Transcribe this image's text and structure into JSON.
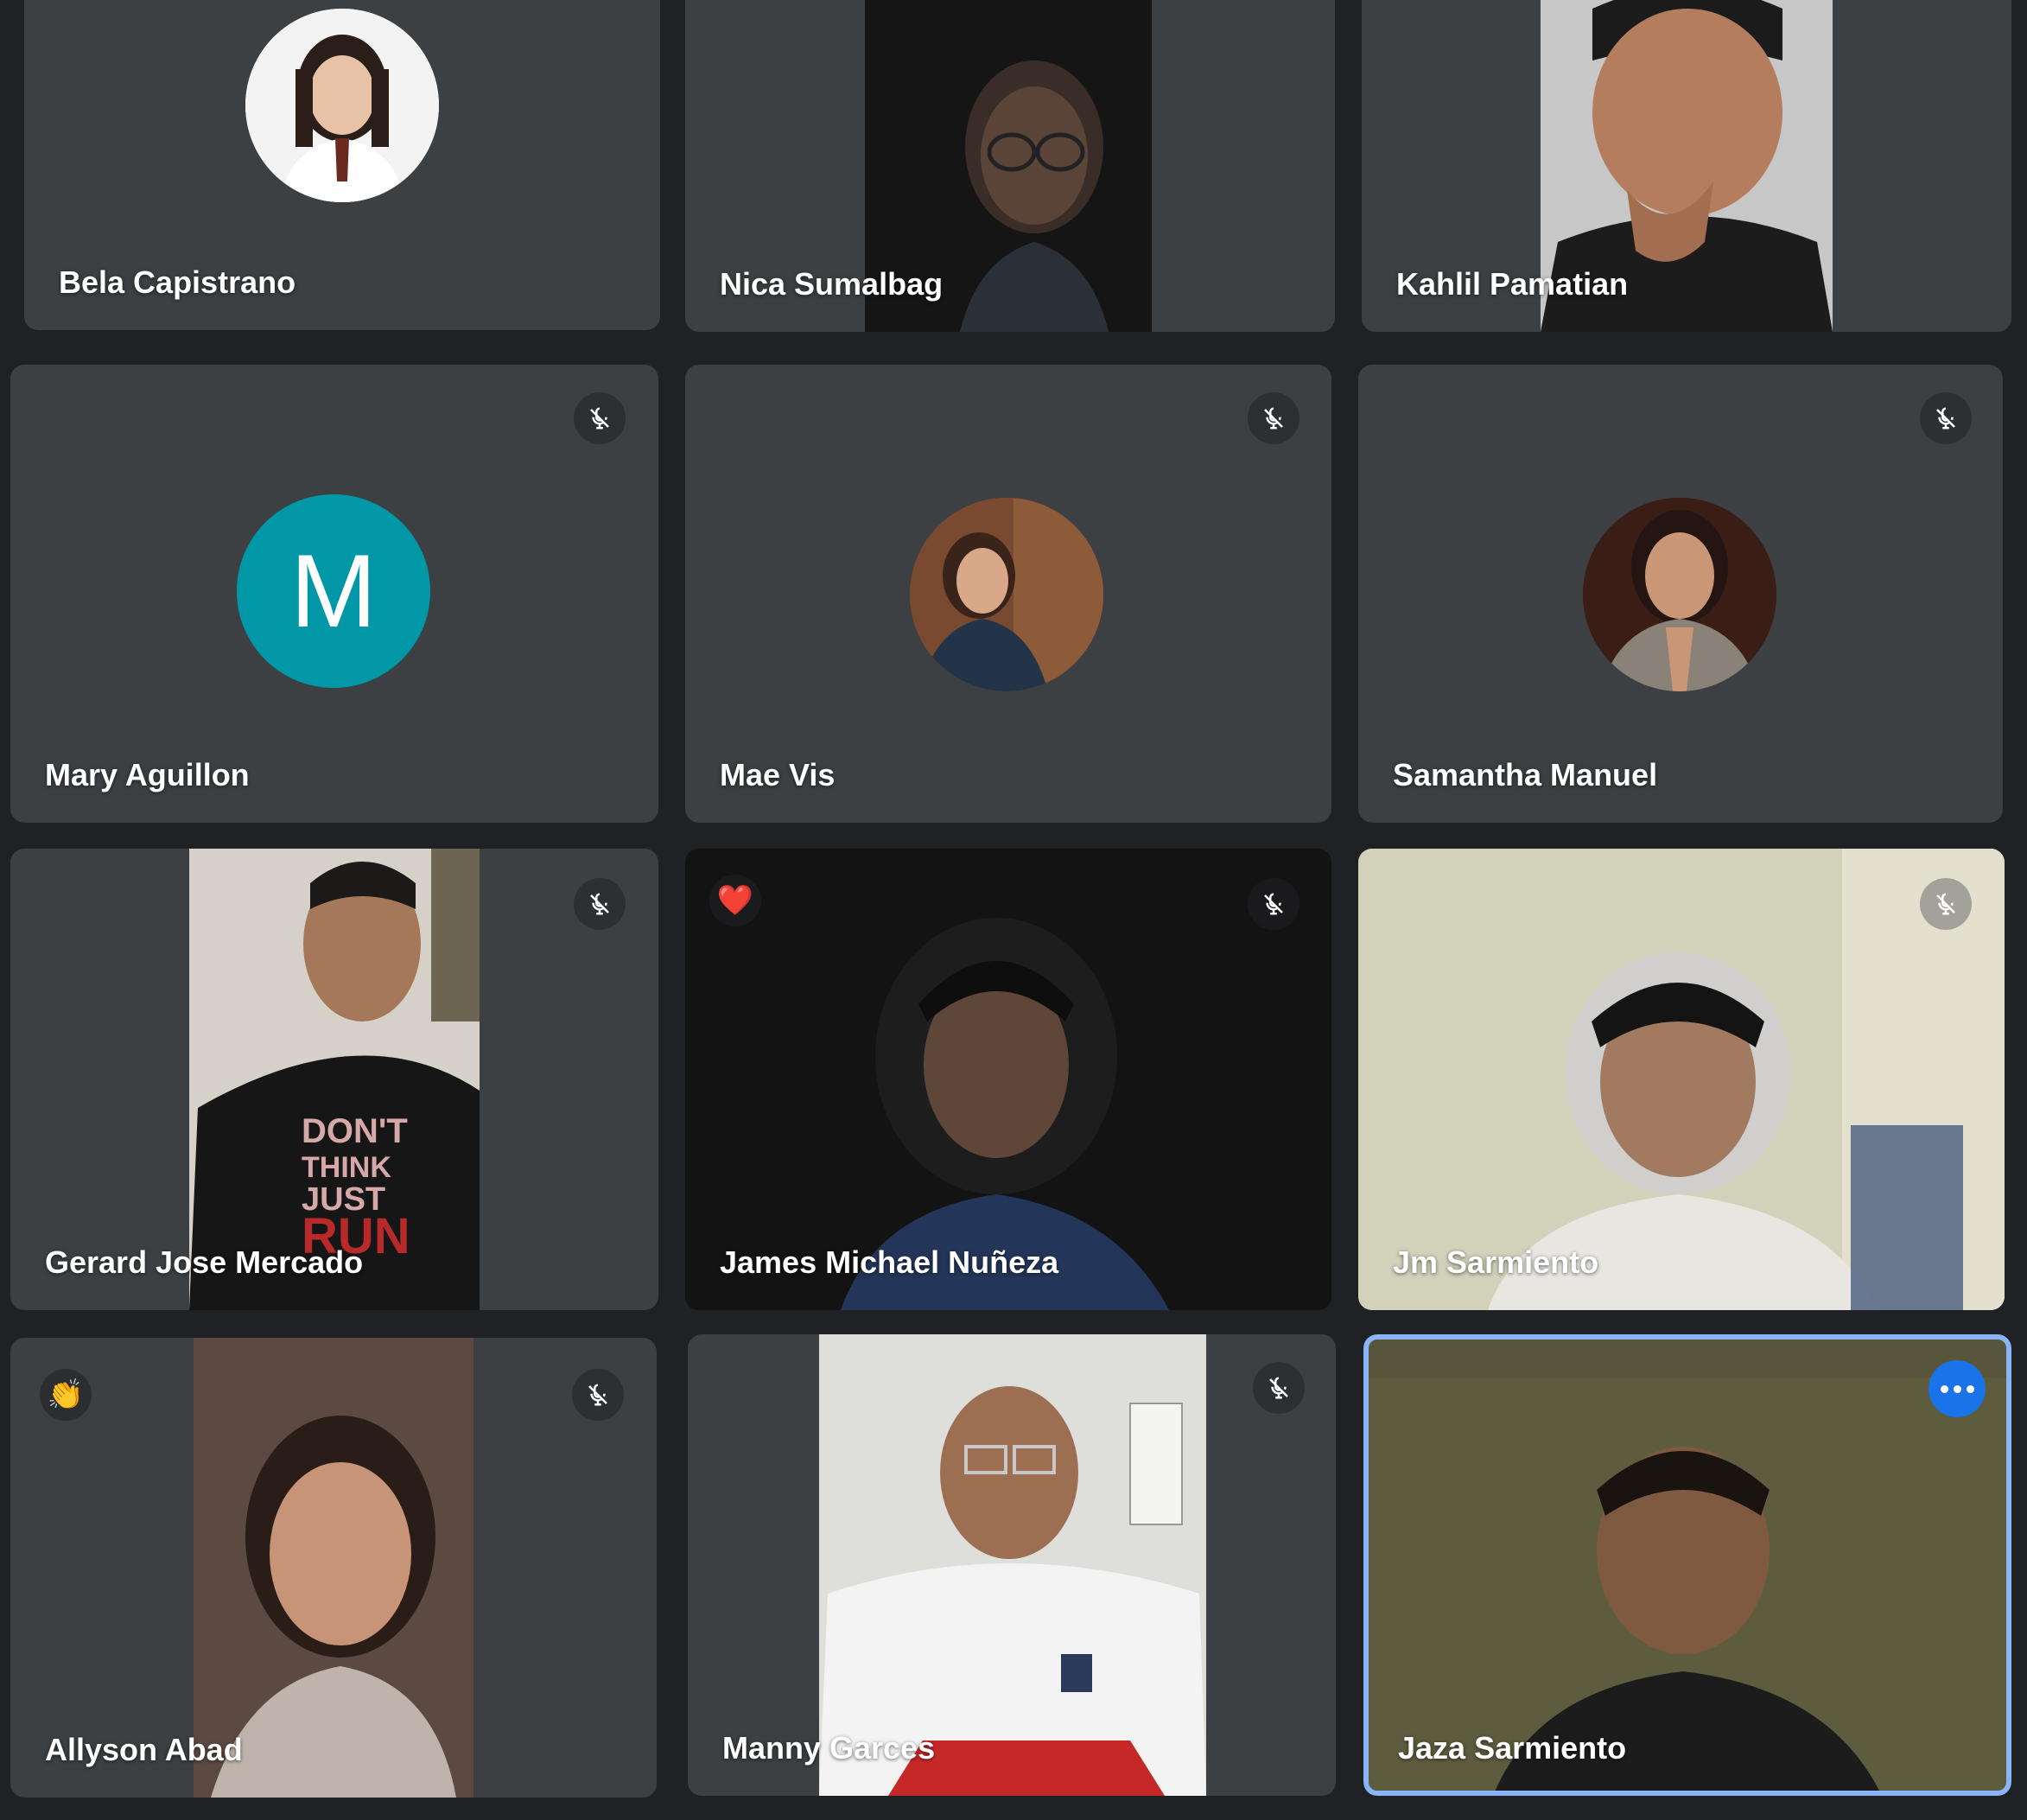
{
  "participants": [
    {
      "name": "Bela Capistrano",
      "muted": false,
      "avatar": "photo"
    },
    {
      "name": "Nica Sumalbag",
      "muted": false,
      "avatar": "video"
    },
    {
      "name": "Kahlil Pamatian",
      "muted": false,
      "avatar": "video"
    },
    {
      "name": "Mary Aguillon",
      "muted": true,
      "avatar": "letter",
      "avatar_letter": "M",
      "avatar_color": "#0097a7"
    },
    {
      "name": "Mae Vis",
      "muted": true,
      "avatar": "photo"
    },
    {
      "name": "Samantha Manuel",
      "muted": true,
      "avatar": "photo"
    },
    {
      "name": "Gerard Jose Mercado",
      "muted": true,
      "avatar": "video",
      "shirt_text": "DON'T THINK JUST RUN"
    },
    {
      "name": "James Michael Nuñeza",
      "muted": true,
      "avatar": "video",
      "reaction": "❤️"
    },
    {
      "name": "Jm Sarmiento",
      "muted": true,
      "avatar": "video"
    },
    {
      "name": "Allyson Abad",
      "muted": true,
      "avatar": "video",
      "reaction": "👏"
    },
    {
      "name": "Manny Garces",
      "muted": true,
      "avatar": "video"
    },
    {
      "name": "Jaza Sarmiento",
      "muted": false,
      "avatar": "video",
      "active_speaker": true
    }
  ],
  "icons": {
    "mic_off": "mic-off-icon",
    "more": "more-options-icon"
  },
  "colors": {
    "tile_bg": "#3c4043",
    "page_bg": "#202124",
    "active_border": "#8ab4f8",
    "accent": "#1a73e8"
  }
}
